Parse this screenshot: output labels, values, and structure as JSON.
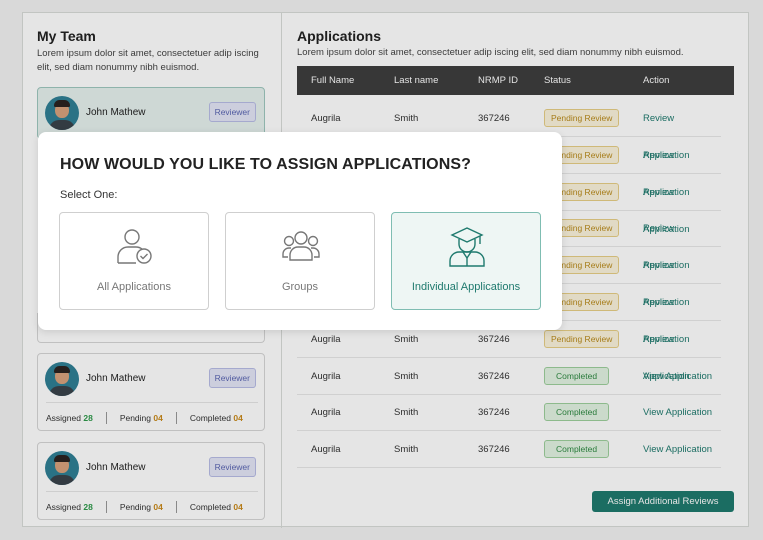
{
  "team": {
    "title": "My Team",
    "description": "Lorem ipsum dolor sit amet, consectetuer adip iscing elit, sed diam nonummy nibh euismod.",
    "members": [
      {
        "name": "John Mathew",
        "role": "Reviewer"
      },
      {
        "name": "John Mathew",
        "role": "Reviewer",
        "assigned_label": "Assigned",
        "assigned": "28",
        "pending_label": "Pending",
        "pending": "04",
        "completed_label": "Completed",
        "completed": "04"
      },
      {
        "name": "John Mathew",
        "role": "Reviewer",
        "assigned_label": "Assigned",
        "assigned": "28",
        "pending_label": "Pending",
        "pending": "04",
        "completed_label": "Completed",
        "completed": "04"
      }
    ]
  },
  "applications": {
    "title": "Applications",
    "description": "Lorem ipsum dolor sit amet, consectetuer adip iscing elit, sed diam nonummy nibh euismod.",
    "columns": [
      "Full Name",
      "Last name",
      "NRMP ID",
      "Status",
      "Action"
    ],
    "rows": [
      {
        "first": "Augrila",
        "last": "Smith",
        "id": "367246",
        "status": "Pending Review",
        "action": "Review Application"
      },
      {
        "first": "",
        "last": "",
        "id": "",
        "status": "Pending Review",
        "action": "Review Application"
      },
      {
        "first": "",
        "last": "",
        "id": "",
        "status": "Pending Review",
        "action": "Review Application"
      },
      {
        "first": "",
        "last": "",
        "id": "",
        "status": "Pending Review",
        "action": "Review Application"
      },
      {
        "first": "",
        "last": "",
        "id": "",
        "status": "Pending Review",
        "action": "Review Application"
      },
      {
        "first": "",
        "last": "",
        "id": "",
        "status": "Pending Review",
        "action": "Review Application"
      },
      {
        "first": "Augrila",
        "last": "Smith",
        "id": "367246",
        "status": "Pending Review",
        "action": "Review Application"
      },
      {
        "first": "Augrila",
        "last": "Smith",
        "id": "367246",
        "status": "Completed",
        "action": "View Application"
      },
      {
        "first": "Augrila",
        "last": "Smith",
        "id": "367246",
        "status": "Completed",
        "action": "View Application"
      },
      {
        "first": "Augrila",
        "last": "Smith",
        "id": "367246",
        "status": "Completed",
        "action": "View Application"
      }
    ],
    "assign_button": "Assign Additional Reviews"
  },
  "modal": {
    "title": "HOW WOULD YOU LIKE TO ASSIGN APPLICATIONS?",
    "select_label": "Select One:",
    "options": [
      {
        "label": "All Applications",
        "icon": "user-check-icon",
        "selected": false
      },
      {
        "label": "Groups",
        "icon": "group-icon",
        "selected": false
      },
      {
        "label": "Individual Applications",
        "icon": "graduate-icon",
        "selected": true
      }
    ]
  },
  "colors": {
    "accent": "#1f7a6e",
    "pending": "#b98b1c",
    "completed": "#2f8a43",
    "reviewer": "#5b66b3"
  }
}
